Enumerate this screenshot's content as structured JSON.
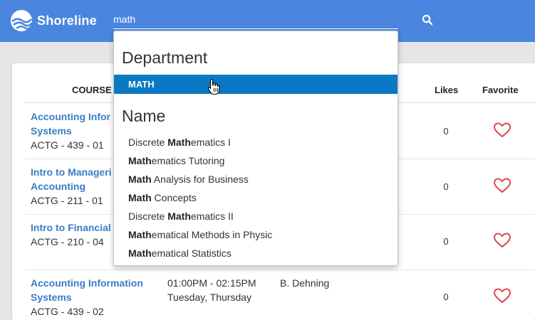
{
  "app": {
    "name": "Shoreline"
  },
  "search": {
    "value": "math"
  },
  "table": {
    "headers": {
      "course": "COURSE",
      "likes": "Likes",
      "favorite": "Favorite"
    },
    "rows": [
      {
        "title_line1": "Accounting Infor",
        "title_line2": "Systems",
        "code": "ACTG - 439 - 01",
        "likes": "0"
      },
      {
        "title_line1": "Intro to Manageri",
        "title_line2": "Accounting",
        "code": "ACTG - 211 - 01",
        "likes": "0"
      },
      {
        "title_line1": "Intro to Financial",
        "title_line2": "",
        "code": "ACTG - 210 - 04",
        "likes": "0"
      },
      {
        "title_line1": "Accounting Information",
        "title_line2": "Systems",
        "code": "ACTG - 439 - 02",
        "time": "01:00PM - 02:15PM",
        "days": "Tuesday, Thursday",
        "instructor": "B. Dehning",
        "likes": "0"
      }
    ]
  },
  "dropdown": {
    "department_header": "Department",
    "department_item": "MATH",
    "name_header": "Name",
    "items": [
      {
        "pre": "Discrete ",
        "match": "Math",
        "post": "ematics I"
      },
      {
        "pre": "",
        "match": "Math",
        "post": "ematics Tutoring"
      },
      {
        "pre": "",
        "match": "Math",
        "post": " Analysis for Business"
      },
      {
        "pre": "",
        "match": "Math",
        "post": " Concepts"
      },
      {
        "pre": "Discrete ",
        "match": "Math",
        "post": "ematics II"
      },
      {
        "pre": "",
        "match": "Math",
        "post": "ematical Methods in Physic"
      },
      {
        "pre": "",
        "match": "Math",
        "post": "ematical Statistics"
      }
    ]
  },
  "colors": {
    "topbar": "#4a86e0",
    "link": "#3b7cc6",
    "highlight": "#0b78c3",
    "heart": "#e04848"
  }
}
